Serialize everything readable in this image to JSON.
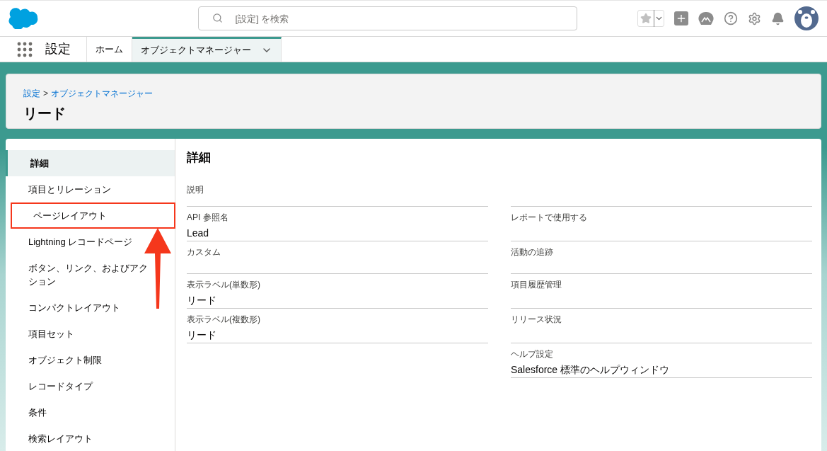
{
  "header": {
    "search": {
      "placeholder": "[設定] を検索"
    }
  },
  "nav": {
    "app_name": "設定",
    "tabs": [
      {
        "label": "ホーム",
        "selected": false,
        "has_menu": false
      },
      {
        "label": "オブジェクトマネージャー",
        "selected": true,
        "has_menu": true
      }
    ]
  },
  "page_header": {
    "breadcrumbs": [
      "設定",
      "オブジェクトマネージャー"
    ],
    "separator": ">",
    "title": "リード"
  },
  "sidebar": {
    "items": [
      {
        "label": "詳細",
        "selected": true,
        "annotated": false
      },
      {
        "label": "項目とリレーション",
        "selected": false,
        "annotated": false
      },
      {
        "label": "ページレイアウト",
        "selected": false,
        "annotated": true
      },
      {
        "label": "Lightning レコードページ",
        "selected": false,
        "annotated": false
      },
      {
        "label": "ボタン、リンク、およびアクション",
        "selected": false,
        "annotated": false
      },
      {
        "label": "コンパクトレイアウト",
        "selected": false,
        "annotated": false
      },
      {
        "label": "項目セット",
        "selected": false,
        "annotated": false
      },
      {
        "label": "オブジェクト制限",
        "selected": false,
        "annotated": false
      },
      {
        "label": "レコードタイプ",
        "selected": false,
        "annotated": false
      },
      {
        "label": "条件",
        "selected": false,
        "annotated": false
      },
      {
        "label": "検索レイアウト",
        "selected": false,
        "annotated": false
      }
    ]
  },
  "detail": {
    "title": "詳細",
    "rows": [
      {
        "left": {
          "label": "説明"
        }
      },
      {
        "left": {
          "label": "API 参照名",
          "value": "Lead"
        },
        "right": {
          "label": "レポートで使用する"
        }
      },
      {
        "left": {
          "label": "カスタム"
        },
        "right": {
          "label": "活動の追跡"
        }
      },
      {
        "left": {
          "label": "表示ラベル(単数形)",
          "value": "リード"
        },
        "right": {
          "label": "項目履歴管理"
        }
      },
      {
        "left": {
          "label": "表示ラベル(複数形)",
          "value": "リード"
        },
        "right": {
          "label": "リリース状況"
        }
      },
      {
        "right": {
          "label": "ヘルプ設定",
          "value": "Salesforce 標準のヘルプウィンドウ"
        }
      }
    ]
  }
}
